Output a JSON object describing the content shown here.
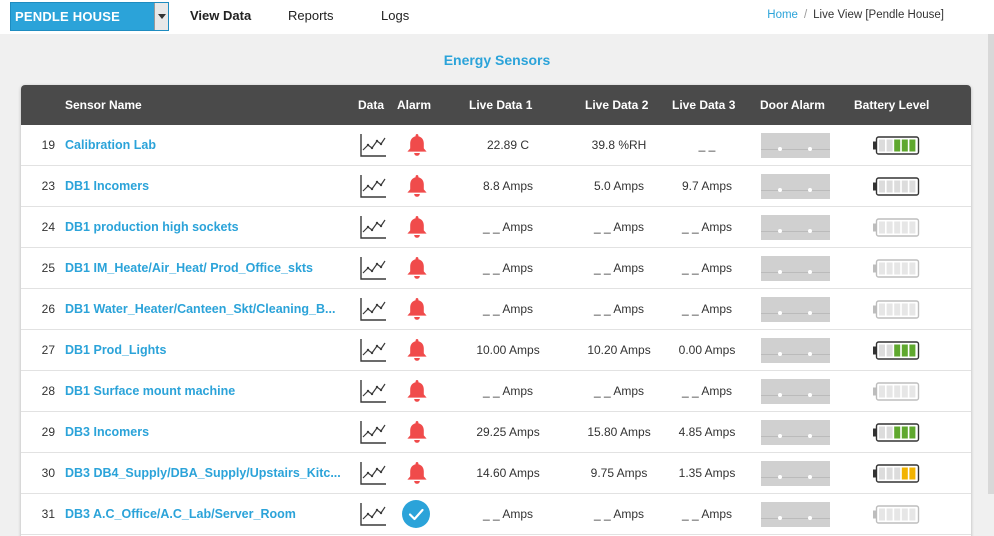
{
  "header": {
    "site_selector": "PENDLE HOUSE",
    "nav": [
      {
        "label": "View Data",
        "active": true
      },
      {
        "label": "Reports",
        "active": false
      },
      {
        "label": "Logs",
        "active": false
      }
    ],
    "breadcrumb": {
      "home": "Home",
      "separator": "/",
      "current": "Live View [Pendle House]"
    }
  },
  "page_title": "Energy Sensors",
  "table": {
    "columns": {
      "name": "Sensor Name",
      "data": "Data",
      "alarm": "Alarm",
      "live1": "Live Data 1",
      "live2": "Live Data 2",
      "live3": "Live Data 3",
      "door": "Door Alarm",
      "battery": "Battery Level"
    },
    "rows": [
      {
        "num": "19",
        "name": "Calibration Lab",
        "live1": "22.89 C",
        "live2": "39.8 %RH",
        "live3": "_ _",
        "alarm": "bell",
        "battery": "green",
        "bars": 3
      },
      {
        "num": "23",
        "name": "DB1 Incomers",
        "live1": "8.8 Amps",
        "live2": "5.0 Amps",
        "live3": "9.7 Amps",
        "alarm": "bell",
        "battery": "empty",
        "bars": 0
      },
      {
        "num": "24",
        "name": "DB1 production high sockets",
        "live1": "_ _ Amps",
        "live2": "_ _ Amps",
        "live3": "_ _ Amps",
        "alarm": "bell",
        "battery": "inactive",
        "bars": 0
      },
      {
        "num": "25",
        "name": "DB1 IM_Heate/Air_Heat/ Prod_Office_skts",
        "live1": "_ _ Amps",
        "live2": "_ _ Amps",
        "live3": "_ _ Amps",
        "alarm": "bell",
        "battery": "inactive",
        "bars": 0
      },
      {
        "num": "26",
        "name": "DB1 Water_Heater/Canteen_Skt/Cleaning_B...",
        "live1": "_ _ Amps",
        "live2": "_ _ Amps",
        "live3": "_ _ Amps",
        "alarm": "bell",
        "battery": "inactive",
        "bars": 0
      },
      {
        "num": "27",
        "name": "DB1 Prod_Lights",
        "live1": "10.00 Amps",
        "live2": "10.20 Amps",
        "live3": "0.00 Amps",
        "alarm": "bell",
        "battery": "green",
        "bars": 3
      },
      {
        "num": "28",
        "name": "DB1 Surface mount machine",
        "live1": "_ _ Amps",
        "live2": "_ _ Amps",
        "live3": "_ _ Amps",
        "alarm": "bell",
        "battery": "inactive",
        "bars": 0
      },
      {
        "num": "29",
        "name": "DB3 Incomers",
        "live1": "29.25 Amps",
        "live2": "15.80 Amps",
        "live3": "4.85 Amps",
        "alarm": "bell",
        "battery": "green",
        "bars": 3
      },
      {
        "num": "30",
        "name": "DB3 DB4_Supply/DBA_Supply/Upstairs_Kitc...",
        "live1": "14.60 Amps",
        "live2": "9.75 Amps",
        "live3": "1.35 Amps",
        "alarm": "bell",
        "battery": "yellow",
        "bars": 2
      },
      {
        "num": "31",
        "name": "DB3 A.C_Office/A.C_Lab/Server_Room",
        "live1": "_ _ Amps",
        "live2": "_ _ Amps",
        "live3": "_ _ Amps",
        "alarm": "ok",
        "battery": "inactive",
        "bars": 0
      }
    ]
  },
  "colors": {
    "accent": "#2ba3d9",
    "header_bg": "#4a4a4a",
    "alarm_red": "#f04b4b",
    "battery_green": "#5fa82e",
    "battery_yellow": "#f2b300"
  }
}
